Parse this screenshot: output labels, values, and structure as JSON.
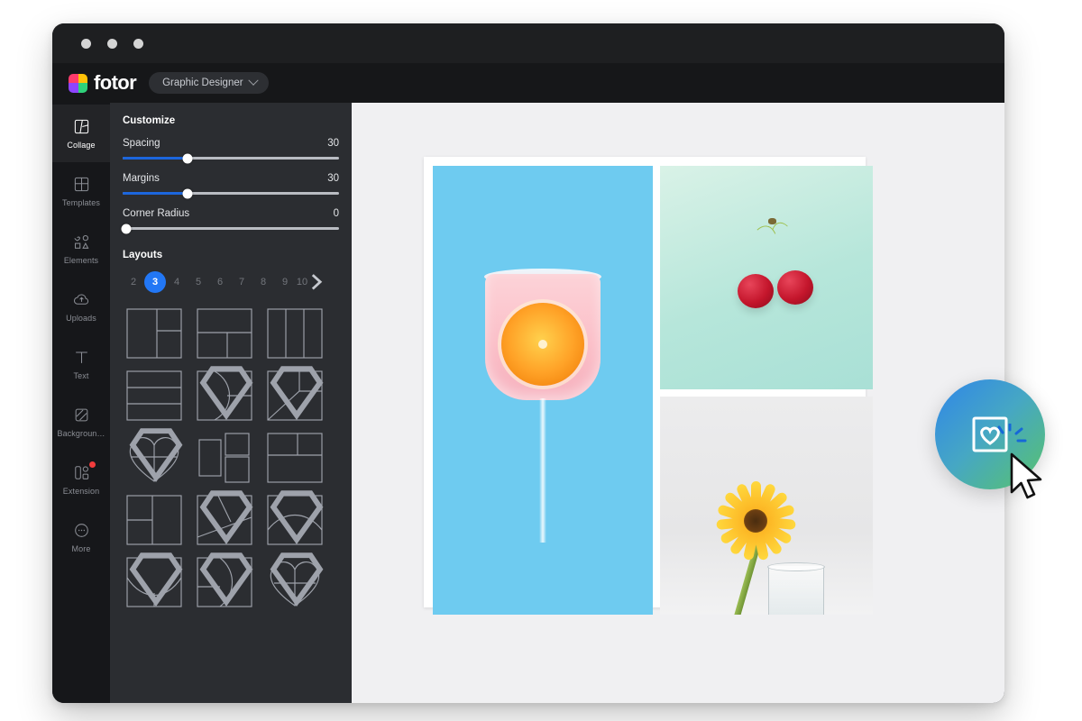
{
  "window": {
    "traffic_lights": [
      "close",
      "minimize",
      "maximize"
    ]
  },
  "header": {
    "brand_name": "fotor",
    "workspace_label": "Graphic Designer",
    "workspace_chevron": "chevron-down-icon"
  },
  "sidebar": {
    "items": [
      {
        "label": "Collage",
        "icon": "collage-icon",
        "active": true,
        "badge": false
      },
      {
        "label": "Templates",
        "icon": "templates-icon",
        "active": false,
        "badge": false
      },
      {
        "label": "Elements",
        "icon": "elements-icon",
        "active": false,
        "badge": false
      },
      {
        "label": "Uploads",
        "icon": "upload-cloud-icon",
        "active": false,
        "badge": false
      },
      {
        "label": "Text",
        "icon": "text-icon",
        "active": false,
        "badge": false
      },
      {
        "label": "Backgroun…",
        "icon": "background-icon",
        "active": false,
        "badge": false
      },
      {
        "label": "Extension",
        "icon": "extension-icon",
        "active": false,
        "badge": true
      },
      {
        "label": "More",
        "icon": "more-dots-icon",
        "active": false,
        "badge": false
      }
    ]
  },
  "panel": {
    "customize_title": "Customize",
    "controls": [
      {
        "name": "Spacing",
        "value": "30",
        "percent": 30
      },
      {
        "name": "Margins",
        "value": "30",
        "percent": 30
      },
      {
        "name": "Corner Radius",
        "value": "0",
        "percent": 0
      }
    ],
    "layouts_title": "Layouts",
    "pager": {
      "numbers": [
        "2",
        "3",
        "4",
        "5",
        "6",
        "7",
        "8",
        "9",
        "10"
      ],
      "selected": "3",
      "next_icon": "chevron-right-icon"
    },
    "layout_count": 15
  },
  "canvas": {
    "background_color": "#f0f0f2",
    "collage": {
      "border_color": "#ffffff",
      "photos": [
        {
          "name": "cocktail-glass-photo",
          "alt": "Pink cocktail with orange slice on blue background"
        },
        {
          "name": "cherries-photo",
          "alt": "Two red cherries on mint green background"
        },
        {
          "name": "gerbera-photo",
          "alt": "Yellow gerbera flower in a glass of water"
        }
      ]
    }
  },
  "cta": {
    "icon": "framed-heart-icon",
    "gradient_from": "#2f86e8",
    "gradient_to": "#59c36a",
    "cursor_icon": "mouse-pointer-icon",
    "click_burst_color": "#1668d8"
  },
  "colors": {
    "accent_blue": "#2277f5",
    "slider_fill": "#1c66dd",
    "panel_bg": "#2b2d31",
    "rail_bg": "#16171a",
    "badge_red": "#f23c3c"
  }
}
